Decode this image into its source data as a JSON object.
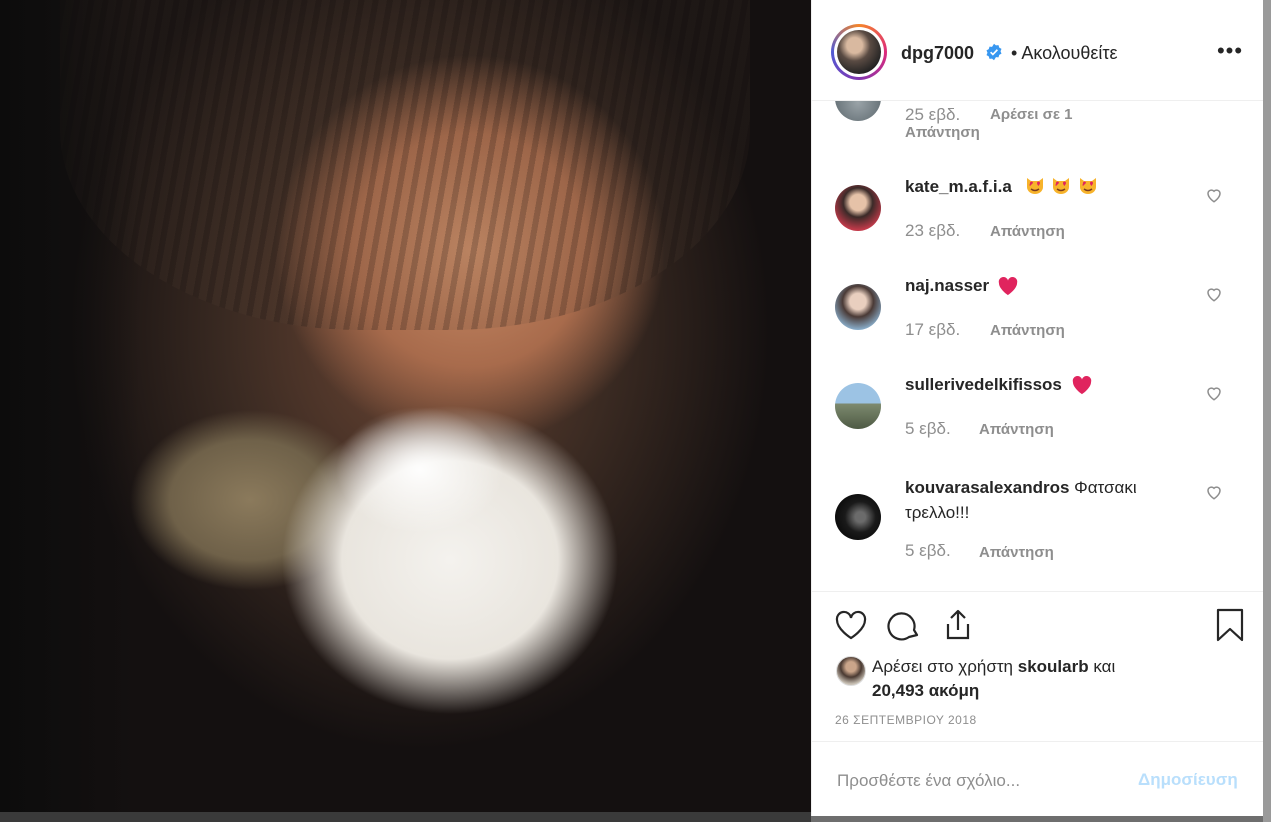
{
  "post": {
    "username": "dpg7000",
    "follow_status": "Ακολουθείτε",
    "separator": "•",
    "more_label": "•••"
  },
  "comments": [
    {
      "username": "",
      "text": "",
      "time": "25 εβδ.",
      "likes": "Αρέσει σε 1",
      "reply": "Απάντηση"
    },
    {
      "username": "kate_m.a.f.i.a",
      "text": "",
      "emoji": "heart-eyes-cat x3",
      "time": "23 εβδ.",
      "reply": "Απάντηση"
    },
    {
      "username": "naj.nasser",
      "text": "",
      "emoji": "red-heart",
      "time": "17 εβδ.",
      "reply": "Απάντηση"
    },
    {
      "username": "sullerivedelkifissos",
      "text": "",
      "emoji": "red-heart",
      "time": "5 εβδ.",
      "reply": "Απάντηση"
    },
    {
      "username": "kouvarasalexandros",
      "text": "Φατσακι τρελλο!!!",
      "time": "5 εβδ.",
      "reply": "Απάντηση"
    }
  ],
  "likes": {
    "prefix": "Αρέσει στο χρήστη",
    "user": "skoularb",
    "conjunction": "και",
    "count": "20,493 ακόμη"
  },
  "date": "26 ΣΕΠΤΕΜΒΡΙΟΥ 2018",
  "add_comment": {
    "placeholder": "Προσθέστε ένα σχόλιο...",
    "post_label": "Δημοσίευση"
  },
  "colors": {
    "text": "#262626",
    "secondary": "#8e8e8e",
    "verified": "#3897f0",
    "heart": "#ed4956",
    "post_disabled": "#b9dffc"
  },
  "icons": [
    "verified-badge-icon",
    "more-options-icon",
    "like-icon",
    "comment-icon",
    "share-icon",
    "save-icon",
    "heart-outline-icon",
    "red-heart-emoji",
    "heart-eyes-cat-emoji"
  ]
}
